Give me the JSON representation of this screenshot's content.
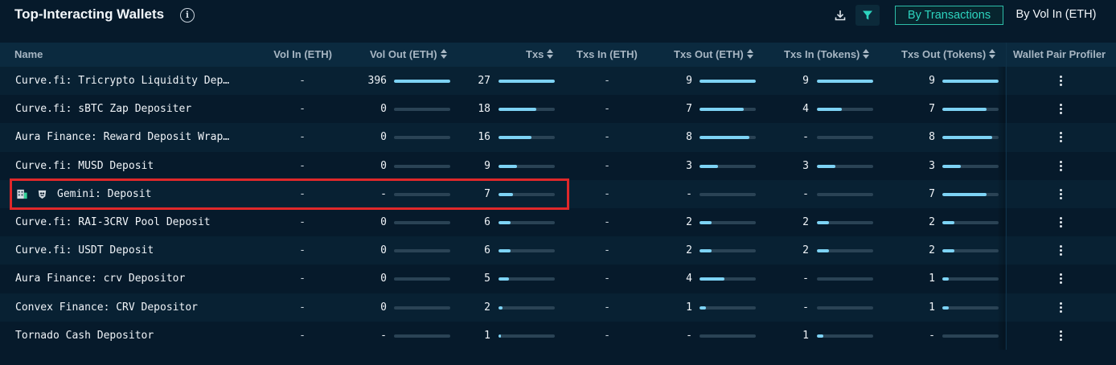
{
  "header": {
    "title": "Top-Interacting Wallets",
    "info_icon": "info-icon",
    "download_icon": "download-icon",
    "filter_icon": "filter-icon",
    "toggle_options": [
      "By Transactions",
      "By Vol In (ETH)"
    ],
    "toggle_selected": "By Transactions"
  },
  "colors": {
    "background": "#061a2b",
    "row_alt": "#082133",
    "header_bg": "#0b2a3f",
    "accent": "#2dd4bf",
    "bar_fill": "#7dd3f5",
    "bar_track": "#2a4355",
    "highlight": "#e0282a"
  },
  "columns": [
    "Name",
    "Vol In (ETH)",
    "Vol Out (ETH)",
    "Txs",
    "Txs In (ETH)",
    "Txs Out (ETH)",
    "Txs In (Tokens)",
    "Txs Out (Tokens)",
    "Wallet Pair Profiler"
  ],
  "rows": [
    {
      "name": "Curve.fi: Tricrypto Liquidity Dep…",
      "vol_in": "-",
      "vol_out": "396",
      "vol_out_bar": 1.0,
      "txs": "27",
      "txs_bar": 1.0,
      "txs_in_eth": "-",
      "txs_out_eth": "9",
      "txs_out_eth_bar": 1.0,
      "txs_in_tok": "9",
      "txs_in_tok_bar": 1.0,
      "txs_out_tok": "9",
      "txs_out_tok_bar": 1.0
    },
    {
      "name": "Curve.fi: sBTC Zap Depositer",
      "vol_in": "-",
      "vol_out": "0",
      "vol_out_bar": 0,
      "txs": "18",
      "txs_bar": 0.67,
      "txs_in_eth": "-",
      "txs_out_eth": "7",
      "txs_out_eth_bar": 0.78,
      "txs_in_tok": "4",
      "txs_in_tok_bar": 0.44,
      "txs_out_tok": "7",
      "txs_out_tok_bar": 0.78
    },
    {
      "name": "Aura Finance: Reward Deposit Wrap…",
      "vol_in": "-",
      "vol_out": "0",
      "vol_out_bar": 0,
      "txs": "16",
      "txs_bar": 0.59,
      "txs_in_eth": "-",
      "txs_out_eth": "8",
      "txs_out_eth_bar": 0.89,
      "txs_in_tok": "-",
      "txs_in_tok_bar": 0,
      "txs_out_tok": "8",
      "txs_out_tok_bar": 0.89
    },
    {
      "name": "Curve.fi: MUSD Deposit",
      "vol_in": "-",
      "vol_out": "0",
      "vol_out_bar": 0,
      "txs": "9",
      "txs_bar": 0.33,
      "txs_in_eth": "-",
      "txs_out_eth": "3",
      "txs_out_eth_bar": 0.33,
      "txs_in_tok": "3",
      "txs_in_tok_bar": 0.33,
      "txs_out_tok": "3",
      "txs_out_tok_bar": 0.33
    },
    {
      "name": "Gemini: Deposit",
      "vol_in": "-",
      "vol_out": "-",
      "vol_out_bar": 0,
      "txs": "7",
      "txs_bar": 0.26,
      "txs_in_eth": "-",
      "txs_out_eth": "-",
      "txs_out_eth_bar": 0,
      "txs_in_tok": "-",
      "txs_in_tok_bar": 0,
      "txs_out_tok": "7",
      "txs_out_tok_bar": 0.78,
      "icons": [
        "exchange-icon",
        "gemini-logo-icon"
      ]
    },
    {
      "name": "Curve.fi: RAI-3CRV Pool Deposit",
      "vol_in": "-",
      "vol_out": "0",
      "vol_out_bar": 0,
      "txs": "6",
      "txs_bar": 0.22,
      "txs_in_eth": "-",
      "txs_out_eth": "2",
      "txs_out_eth_bar": 0.22,
      "txs_in_tok": "2",
      "txs_in_tok_bar": 0.22,
      "txs_out_tok": "2",
      "txs_out_tok_bar": 0.22
    },
    {
      "name": "Curve.fi: USDT Deposit",
      "vol_in": "-",
      "vol_out": "0",
      "vol_out_bar": 0,
      "txs": "6",
      "txs_bar": 0.22,
      "txs_in_eth": "-",
      "txs_out_eth": "2",
      "txs_out_eth_bar": 0.22,
      "txs_in_tok": "2",
      "txs_in_tok_bar": 0.22,
      "txs_out_tok": "2",
      "txs_out_tok_bar": 0.22
    },
    {
      "name": "Aura Finance: crv Depositor",
      "vol_in": "-",
      "vol_out": "0",
      "vol_out_bar": 0,
      "txs": "5",
      "txs_bar": 0.19,
      "txs_in_eth": "-",
      "txs_out_eth": "4",
      "txs_out_eth_bar": 0.44,
      "txs_in_tok": "-",
      "txs_in_tok_bar": 0,
      "txs_out_tok": "1",
      "txs_out_tok_bar": 0.11
    },
    {
      "name": "Convex Finance: CRV Depositor",
      "vol_in": "-",
      "vol_out": "0",
      "vol_out_bar": 0,
      "txs": "2",
      "txs_bar": 0.07,
      "txs_in_eth": "-",
      "txs_out_eth": "1",
      "txs_out_eth_bar": 0.11,
      "txs_in_tok": "-",
      "txs_in_tok_bar": 0,
      "txs_out_tok": "1",
      "txs_out_tok_bar": 0.11
    },
    {
      "name": "Tornado Cash Depositor",
      "vol_in": "-",
      "vol_out": "-",
      "vol_out_bar": 0,
      "txs": "1",
      "txs_bar": 0.04,
      "txs_in_eth": "-",
      "txs_out_eth": "-",
      "txs_out_eth_bar": 0,
      "txs_in_tok": "1",
      "txs_in_tok_bar": 0.11,
      "txs_out_tok": "-",
      "txs_out_tok_bar": 0
    }
  ],
  "row_action_icon": "kebab-menu-icon"
}
